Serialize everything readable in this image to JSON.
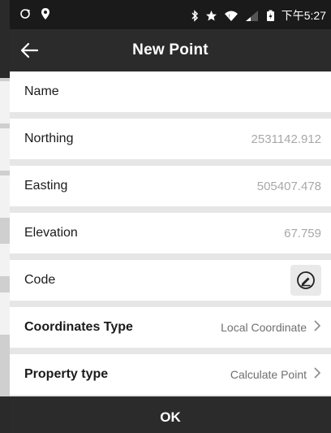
{
  "status_bar": {
    "time": "下午5:27",
    "left_icons": [
      "sync-icon",
      "location-icon"
    ],
    "right_icons": [
      "bluetooth-icon",
      "star-icon",
      "wifi-icon",
      "signal-icon",
      "battery-icon"
    ]
  },
  "app_bar": {
    "title": "New Point",
    "back_icon": "back-arrow-icon"
  },
  "fields": {
    "name": {
      "label": "Name",
      "value": ""
    },
    "northing": {
      "label": "Northing",
      "value": "2531142.912"
    },
    "easting": {
      "label": "Easting",
      "value": "505407.478"
    },
    "elevation": {
      "label": "Elevation",
      "value": "67.759"
    },
    "code": {
      "label": "Code",
      "value": "",
      "button_icon": "edit-pen-icon"
    },
    "coordinates_type": {
      "label": "Coordinates Type",
      "value": "Local Coordinate"
    },
    "property_type": {
      "label": "Property type",
      "value": "Calculate Point"
    }
  },
  "actions": {
    "ok_label": "OK"
  },
  "colors": {
    "app_bar": "#2b2b2b",
    "status_bar": "#1a1a1a",
    "value_text": "#a8a8a8",
    "divider": "#e6e6e6"
  }
}
